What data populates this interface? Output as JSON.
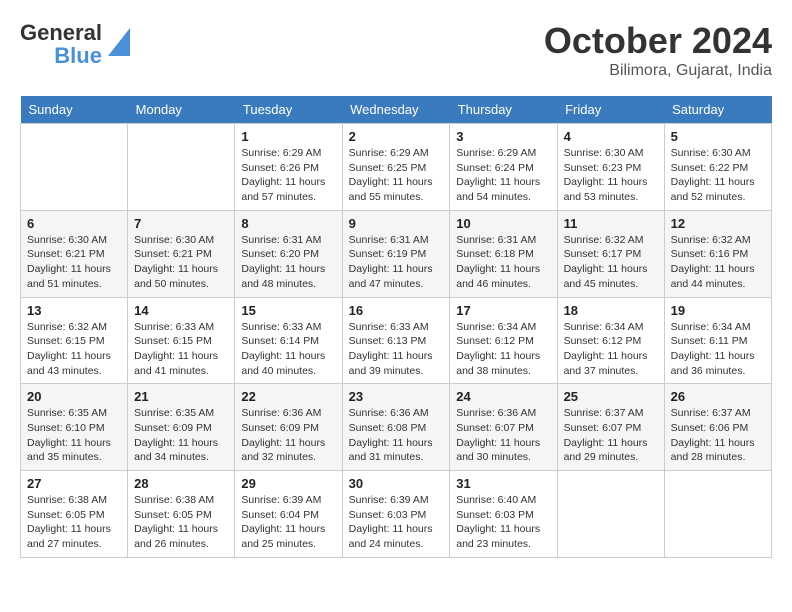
{
  "header": {
    "logo_line1": "General",
    "logo_line2": "Blue",
    "month": "October 2024",
    "location": "Bilimora, Gujarat, India"
  },
  "weekdays": [
    "Sunday",
    "Monday",
    "Tuesday",
    "Wednesday",
    "Thursday",
    "Friday",
    "Saturday"
  ],
  "weeks": [
    [
      {
        "day": "",
        "sunrise": "",
        "sunset": "",
        "daylight": ""
      },
      {
        "day": "",
        "sunrise": "",
        "sunset": "",
        "daylight": ""
      },
      {
        "day": "1",
        "sunrise": "Sunrise: 6:29 AM",
        "sunset": "Sunset: 6:26 PM",
        "daylight": "Daylight: 11 hours and 57 minutes."
      },
      {
        "day": "2",
        "sunrise": "Sunrise: 6:29 AM",
        "sunset": "Sunset: 6:25 PM",
        "daylight": "Daylight: 11 hours and 55 minutes."
      },
      {
        "day": "3",
        "sunrise": "Sunrise: 6:29 AM",
        "sunset": "Sunset: 6:24 PM",
        "daylight": "Daylight: 11 hours and 54 minutes."
      },
      {
        "day": "4",
        "sunrise": "Sunrise: 6:30 AM",
        "sunset": "Sunset: 6:23 PM",
        "daylight": "Daylight: 11 hours and 53 minutes."
      },
      {
        "day": "5",
        "sunrise": "Sunrise: 6:30 AM",
        "sunset": "Sunset: 6:22 PM",
        "daylight": "Daylight: 11 hours and 52 minutes."
      }
    ],
    [
      {
        "day": "6",
        "sunrise": "Sunrise: 6:30 AM",
        "sunset": "Sunset: 6:21 PM",
        "daylight": "Daylight: 11 hours and 51 minutes."
      },
      {
        "day": "7",
        "sunrise": "Sunrise: 6:30 AM",
        "sunset": "Sunset: 6:21 PM",
        "daylight": "Daylight: 11 hours and 50 minutes."
      },
      {
        "day": "8",
        "sunrise": "Sunrise: 6:31 AM",
        "sunset": "Sunset: 6:20 PM",
        "daylight": "Daylight: 11 hours and 48 minutes."
      },
      {
        "day": "9",
        "sunrise": "Sunrise: 6:31 AM",
        "sunset": "Sunset: 6:19 PM",
        "daylight": "Daylight: 11 hours and 47 minutes."
      },
      {
        "day": "10",
        "sunrise": "Sunrise: 6:31 AM",
        "sunset": "Sunset: 6:18 PM",
        "daylight": "Daylight: 11 hours and 46 minutes."
      },
      {
        "day": "11",
        "sunrise": "Sunrise: 6:32 AM",
        "sunset": "Sunset: 6:17 PM",
        "daylight": "Daylight: 11 hours and 45 minutes."
      },
      {
        "day": "12",
        "sunrise": "Sunrise: 6:32 AM",
        "sunset": "Sunset: 6:16 PM",
        "daylight": "Daylight: 11 hours and 44 minutes."
      }
    ],
    [
      {
        "day": "13",
        "sunrise": "Sunrise: 6:32 AM",
        "sunset": "Sunset: 6:15 PM",
        "daylight": "Daylight: 11 hours and 43 minutes."
      },
      {
        "day": "14",
        "sunrise": "Sunrise: 6:33 AM",
        "sunset": "Sunset: 6:15 PM",
        "daylight": "Daylight: 11 hours and 41 minutes."
      },
      {
        "day": "15",
        "sunrise": "Sunrise: 6:33 AM",
        "sunset": "Sunset: 6:14 PM",
        "daylight": "Daylight: 11 hours and 40 minutes."
      },
      {
        "day": "16",
        "sunrise": "Sunrise: 6:33 AM",
        "sunset": "Sunset: 6:13 PM",
        "daylight": "Daylight: 11 hours and 39 minutes."
      },
      {
        "day": "17",
        "sunrise": "Sunrise: 6:34 AM",
        "sunset": "Sunset: 6:12 PM",
        "daylight": "Daylight: 11 hours and 38 minutes."
      },
      {
        "day": "18",
        "sunrise": "Sunrise: 6:34 AM",
        "sunset": "Sunset: 6:12 PM",
        "daylight": "Daylight: 11 hours and 37 minutes."
      },
      {
        "day": "19",
        "sunrise": "Sunrise: 6:34 AM",
        "sunset": "Sunset: 6:11 PM",
        "daylight": "Daylight: 11 hours and 36 minutes."
      }
    ],
    [
      {
        "day": "20",
        "sunrise": "Sunrise: 6:35 AM",
        "sunset": "Sunset: 6:10 PM",
        "daylight": "Daylight: 11 hours and 35 minutes."
      },
      {
        "day": "21",
        "sunrise": "Sunrise: 6:35 AM",
        "sunset": "Sunset: 6:09 PM",
        "daylight": "Daylight: 11 hours and 34 minutes."
      },
      {
        "day": "22",
        "sunrise": "Sunrise: 6:36 AM",
        "sunset": "Sunset: 6:09 PM",
        "daylight": "Daylight: 11 hours and 32 minutes."
      },
      {
        "day": "23",
        "sunrise": "Sunrise: 6:36 AM",
        "sunset": "Sunset: 6:08 PM",
        "daylight": "Daylight: 11 hours and 31 minutes."
      },
      {
        "day": "24",
        "sunrise": "Sunrise: 6:36 AM",
        "sunset": "Sunset: 6:07 PM",
        "daylight": "Daylight: 11 hours and 30 minutes."
      },
      {
        "day": "25",
        "sunrise": "Sunrise: 6:37 AM",
        "sunset": "Sunset: 6:07 PM",
        "daylight": "Daylight: 11 hours and 29 minutes."
      },
      {
        "day": "26",
        "sunrise": "Sunrise: 6:37 AM",
        "sunset": "Sunset: 6:06 PM",
        "daylight": "Daylight: 11 hours and 28 minutes."
      }
    ],
    [
      {
        "day": "27",
        "sunrise": "Sunrise: 6:38 AM",
        "sunset": "Sunset: 6:05 PM",
        "daylight": "Daylight: 11 hours and 27 minutes."
      },
      {
        "day": "28",
        "sunrise": "Sunrise: 6:38 AM",
        "sunset": "Sunset: 6:05 PM",
        "daylight": "Daylight: 11 hours and 26 minutes."
      },
      {
        "day": "29",
        "sunrise": "Sunrise: 6:39 AM",
        "sunset": "Sunset: 6:04 PM",
        "daylight": "Daylight: 11 hours and 25 minutes."
      },
      {
        "day": "30",
        "sunrise": "Sunrise: 6:39 AM",
        "sunset": "Sunset: 6:03 PM",
        "daylight": "Daylight: 11 hours and 24 minutes."
      },
      {
        "day": "31",
        "sunrise": "Sunrise: 6:40 AM",
        "sunset": "Sunset: 6:03 PM",
        "daylight": "Daylight: 11 hours and 23 minutes."
      },
      {
        "day": "",
        "sunrise": "",
        "sunset": "",
        "daylight": ""
      },
      {
        "day": "",
        "sunrise": "",
        "sunset": "",
        "daylight": ""
      }
    ]
  ]
}
